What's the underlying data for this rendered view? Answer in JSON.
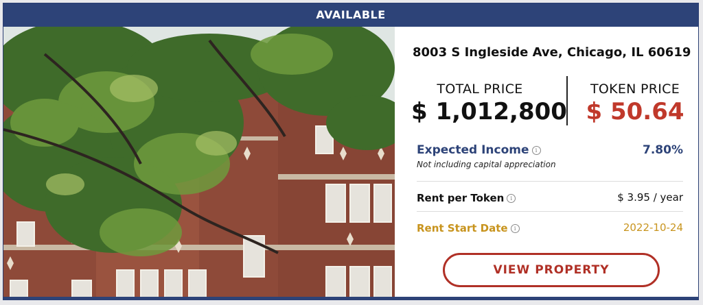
{
  "banner": {
    "label": "AVAILABLE"
  },
  "listing": {
    "address": "8003 S Ingleside Ave, Chicago, IL 60619",
    "total_price_label": "TOTAL PRICE",
    "total_price_value": "$ 1,012,800",
    "token_price_label": "TOKEN PRICE",
    "token_price_value": "$ 50.64",
    "expected_income_label": "Expected Income",
    "expected_income_value": "7.80%",
    "expected_income_note": "Not including capital appreciation",
    "rent_per_token_label": "Rent per Token",
    "rent_per_token_value": "$ 3.95 / year",
    "rent_start_label": "Rent Start Date",
    "rent_start_value": "2022-10-24",
    "cta_label": "VIEW PROPERTY"
  },
  "icons": {
    "info": "info-circle-icon"
  },
  "colors": {
    "navy": "#2d4378",
    "token_red": "#c0392b",
    "cta_red": "#b03026",
    "gold": "#c8941e"
  }
}
